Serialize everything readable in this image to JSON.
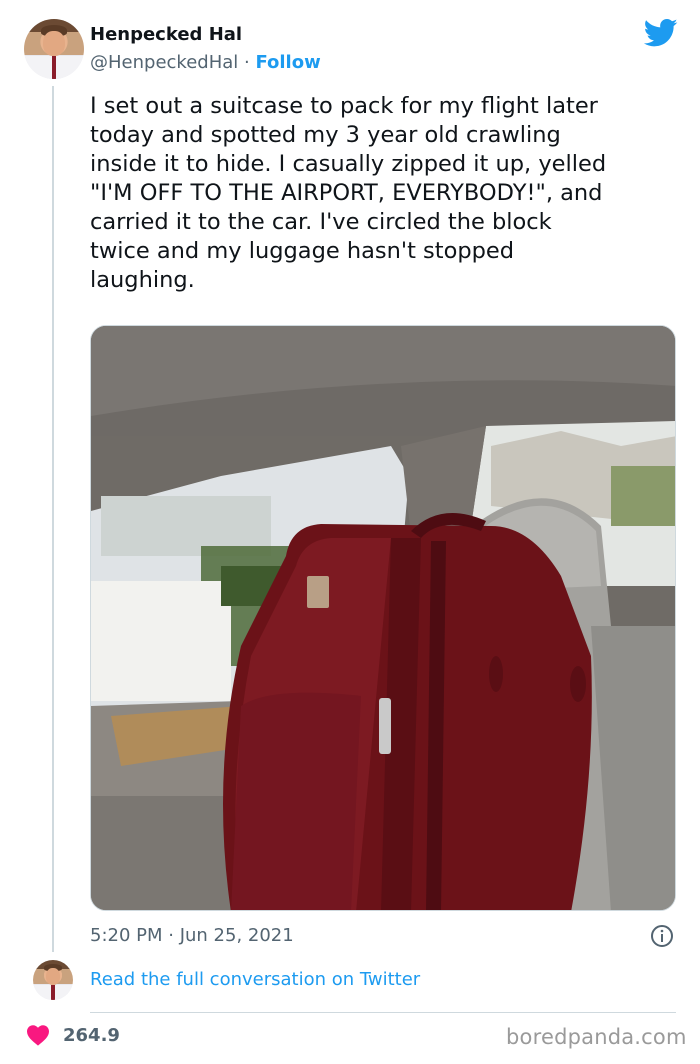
{
  "author": {
    "name": "Henpecked Hal",
    "handle": "@HenpeckedHal",
    "separator": " · ",
    "follow_label": "Follow"
  },
  "icons": {
    "brand": "twitter-bird-icon",
    "info": "info-icon",
    "like": "heart-icon"
  },
  "colors": {
    "accent": "#1d9bf0",
    "text": "#0f1419",
    "muted": "#536471",
    "like": "#f91880"
  },
  "tweet": {
    "text": "I set out a suitcase to pack for my flight later\ntoday and spotted my 3 year old crawling\ninside it to hide. I casually zipped it up, yelled\n\"I'M OFF TO THE AIRPORT, EVERYBODY!\", and\ncarried it to the car. I've circled the block\ntwice and my luggage hasn't stopped\nlaughing.",
    "timestamp": "5:20 PM · Jun 25, 2021"
  },
  "footer": {
    "read_link": "Read the full conversation on Twitter",
    "likes": "264.9",
    "watermark": "boredpanda.com"
  }
}
